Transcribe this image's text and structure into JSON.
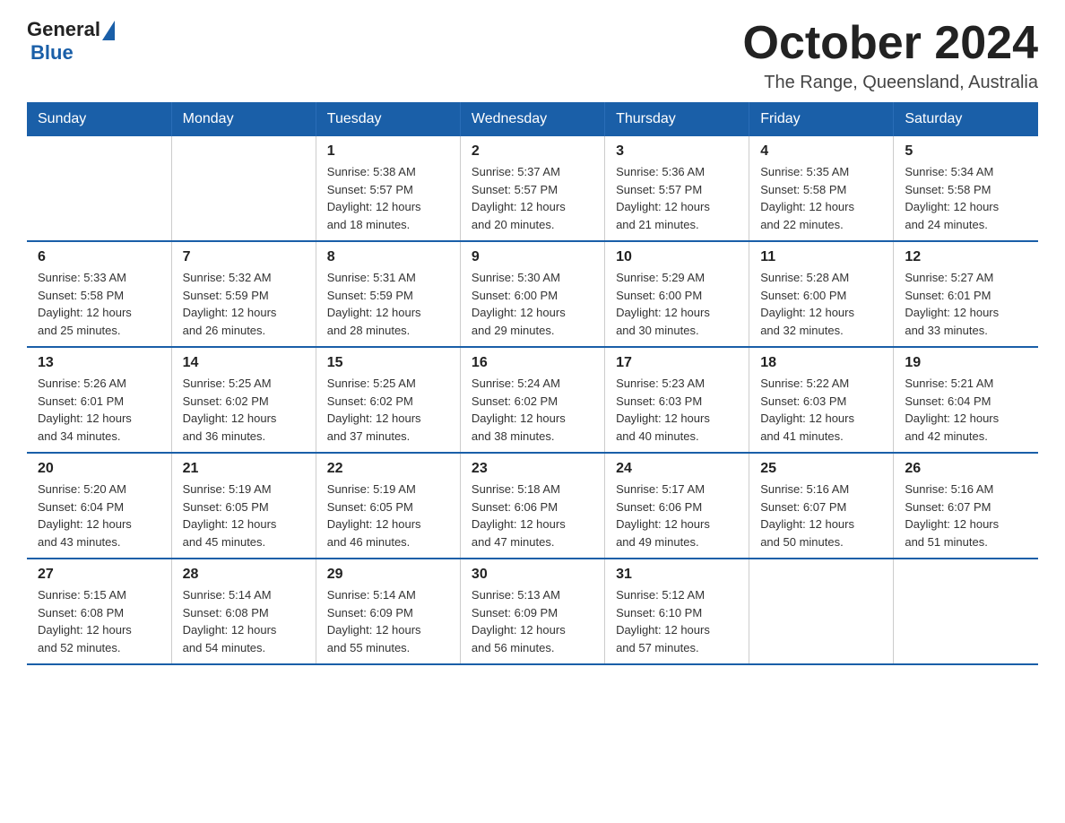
{
  "logo": {
    "general": "General",
    "blue": "Blue"
  },
  "header": {
    "month": "October 2024",
    "location": "The Range, Queensland, Australia"
  },
  "days_of_week": [
    "Sunday",
    "Monday",
    "Tuesday",
    "Wednesday",
    "Thursday",
    "Friday",
    "Saturday"
  ],
  "weeks": [
    [
      {
        "day": "",
        "info": ""
      },
      {
        "day": "",
        "info": ""
      },
      {
        "day": "1",
        "info": "Sunrise: 5:38 AM\nSunset: 5:57 PM\nDaylight: 12 hours\nand 18 minutes."
      },
      {
        "day": "2",
        "info": "Sunrise: 5:37 AM\nSunset: 5:57 PM\nDaylight: 12 hours\nand 20 minutes."
      },
      {
        "day": "3",
        "info": "Sunrise: 5:36 AM\nSunset: 5:57 PM\nDaylight: 12 hours\nand 21 minutes."
      },
      {
        "day": "4",
        "info": "Sunrise: 5:35 AM\nSunset: 5:58 PM\nDaylight: 12 hours\nand 22 minutes."
      },
      {
        "day": "5",
        "info": "Sunrise: 5:34 AM\nSunset: 5:58 PM\nDaylight: 12 hours\nand 24 minutes."
      }
    ],
    [
      {
        "day": "6",
        "info": "Sunrise: 5:33 AM\nSunset: 5:58 PM\nDaylight: 12 hours\nand 25 minutes."
      },
      {
        "day": "7",
        "info": "Sunrise: 5:32 AM\nSunset: 5:59 PM\nDaylight: 12 hours\nand 26 minutes."
      },
      {
        "day": "8",
        "info": "Sunrise: 5:31 AM\nSunset: 5:59 PM\nDaylight: 12 hours\nand 28 minutes."
      },
      {
        "day": "9",
        "info": "Sunrise: 5:30 AM\nSunset: 6:00 PM\nDaylight: 12 hours\nand 29 minutes."
      },
      {
        "day": "10",
        "info": "Sunrise: 5:29 AM\nSunset: 6:00 PM\nDaylight: 12 hours\nand 30 minutes."
      },
      {
        "day": "11",
        "info": "Sunrise: 5:28 AM\nSunset: 6:00 PM\nDaylight: 12 hours\nand 32 minutes."
      },
      {
        "day": "12",
        "info": "Sunrise: 5:27 AM\nSunset: 6:01 PM\nDaylight: 12 hours\nand 33 minutes."
      }
    ],
    [
      {
        "day": "13",
        "info": "Sunrise: 5:26 AM\nSunset: 6:01 PM\nDaylight: 12 hours\nand 34 minutes."
      },
      {
        "day": "14",
        "info": "Sunrise: 5:25 AM\nSunset: 6:02 PM\nDaylight: 12 hours\nand 36 minutes."
      },
      {
        "day": "15",
        "info": "Sunrise: 5:25 AM\nSunset: 6:02 PM\nDaylight: 12 hours\nand 37 minutes."
      },
      {
        "day": "16",
        "info": "Sunrise: 5:24 AM\nSunset: 6:02 PM\nDaylight: 12 hours\nand 38 minutes."
      },
      {
        "day": "17",
        "info": "Sunrise: 5:23 AM\nSunset: 6:03 PM\nDaylight: 12 hours\nand 40 minutes."
      },
      {
        "day": "18",
        "info": "Sunrise: 5:22 AM\nSunset: 6:03 PM\nDaylight: 12 hours\nand 41 minutes."
      },
      {
        "day": "19",
        "info": "Sunrise: 5:21 AM\nSunset: 6:04 PM\nDaylight: 12 hours\nand 42 minutes."
      }
    ],
    [
      {
        "day": "20",
        "info": "Sunrise: 5:20 AM\nSunset: 6:04 PM\nDaylight: 12 hours\nand 43 minutes."
      },
      {
        "day": "21",
        "info": "Sunrise: 5:19 AM\nSunset: 6:05 PM\nDaylight: 12 hours\nand 45 minutes."
      },
      {
        "day": "22",
        "info": "Sunrise: 5:19 AM\nSunset: 6:05 PM\nDaylight: 12 hours\nand 46 minutes."
      },
      {
        "day": "23",
        "info": "Sunrise: 5:18 AM\nSunset: 6:06 PM\nDaylight: 12 hours\nand 47 minutes."
      },
      {
        "day": "24",
        "info": "Sunrise: 5:17 AM\nSunset: 6:06 PM\nDaylight: 12 hours\nand 49 minutes."
      },
      {
        "day": "25",
        "info": "Sunrise: 5:16 AM\nSunset: 6:07 PM\nDaylight: 12 hours\nand 50 minutes."
      },
      {
        "day": "26",
        "info": "Sunrise: 5:16 AM\nSunset: 6:07 PM\nDaylight: 12 hours\nand 51 minutes."
      }
    ],
    [
      {
        "day": "27",
        "info": "Sunrise: 5:15 AM\nSunset: 6:08 PM\nDaylight: 12 hours\nand 52 minutes."
      },
      {
        "day": "28",
        "info": "Sunrise: 5:14 AM\nSunset: 6:08 PM\nDaylight: 12 hours\nand 54 minutes."
      },
      {
        "day": "29",
        "info": "Sunrise: 5:14 AM\nSunset: 6:09 PM\nDaylight: 12 hours\nand 55 minutes."
      },
      {
        "day": "30",
        "info": "Sunrise: 5:13 AM\nSunset: 6:09 PM\nDaylight: 12 hours\nand 56 minutes."
      },
      {
        "day": "31",
        "info": "Sunrise: 5:12 AM\nSunset: 6:10 PM\nDaylight: 12 hours\nand 57 minutes."
      },
      {
        "day": "",
        "info": ""
      },
      {
        "day": "",
        "info": ""
      }
    ]
  ]
}
